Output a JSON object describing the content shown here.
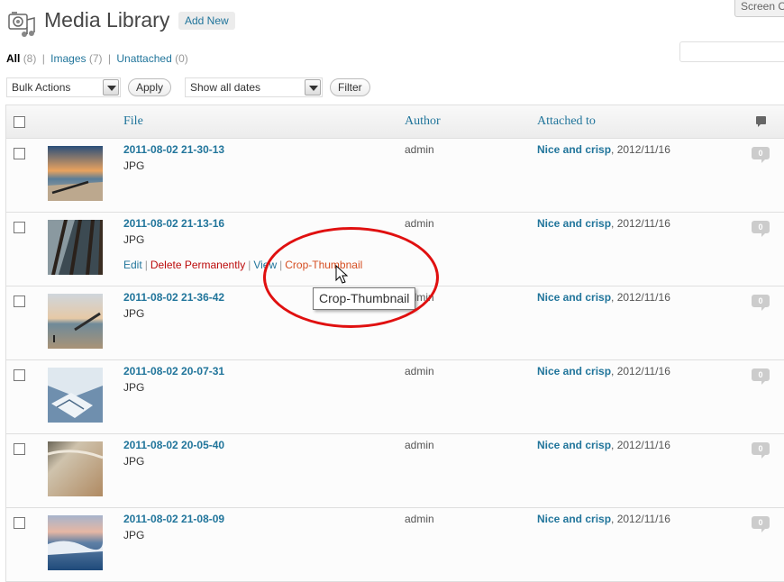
{
  "page": {
    "title": "Media Library",
    "add_new_label": "Add New",
    "screen_options_label": "Screen O"
  },
  "filters": {
    "all_label": "All",
    "all_count": "(8)",
    "images_label": "Images",
    "images_count": "(7)",
    "unattached_label": "Unattached",
    "unattached_count": "(0)",
    "separator": "|"
  },
  "actions": {
    "bulk_actions": "Bulk Actions",
    "apply_label": "Apply",
    "dates": "Show all dates",
    "filter_label": "Filter"
  },
  "table": {
    "columns": {
      "file": "File",
      "author": "Author",
      "attached_to": "Attached to"
    },
    "rows": [
      {
        "file": "2011-08-02 21-30-13",
        "type": "JPG",
        "author": "admin",
        "post": "Nice and crisp",
        "date": ", 2012/11/16",
        "comments": "0"
      },
      {
        "file": "2011-08-02 21-13-16",
        "type": "JPG",
        "author": "admin",
        "post": "Nice and crisp",
        "date": ", 2012/11/16",
        "comments": "0"
      },
      {
        "file": "2011-08-02 21-36-42",
        "type": "JPG",
        "author": "admin",
        "post": "Nice and crisp",
        "date": ", 2012/11/16",
        "comments": "0"
      },
      {
        "file": "2011-08-02 20-07-31",
        "type": "JPG",
        "author": "admin",
        "post": "Nice and crisp",
        "date": ", 2012/11/16",
        "comments": "0"
      },
      {
        "file": "2011-08-02 20-05-40",
        "type": "JPG",
        "author": "admin",
        "post": "Nice and crisp",
        "date": ", 2012/11/16",
        "comments": "0"
      },
      {
        "file": "2011-08-02 21-08-09",
        "type": "JPG",
        "author": "admin",
        "post": "Nice and crisp",
        "date": ", 2012/11/16",
        "comments": "0"
      }
    ]
  },
  "row_actions": {
    "edit": "Edit",
    "delete": "Delete Permanently",
    "view": "View",
    "crop": "Crop-Thumbnail",
    "separator": "|"
  },
  "tooltip": "Crop-Thumbnail",
  "colors": {
    "link": "#21759b",
    "delete": "#bc0b0b",
    "crop": "#d54e21",
    "highlight_circle": "#e01010"
  }
}
